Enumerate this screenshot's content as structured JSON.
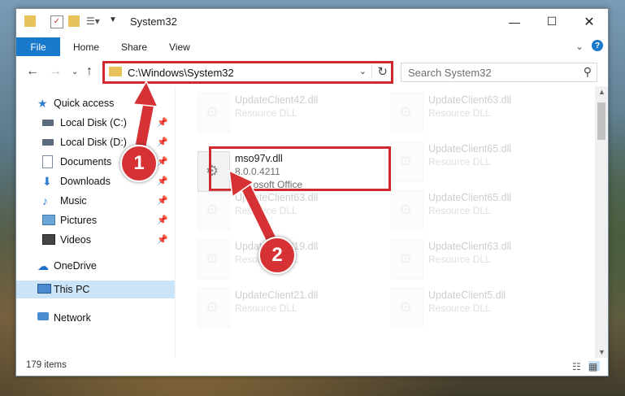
{
  "window": {
    "title": "System32"
  },
  "ribbon": {
    "tabs": [
      "File",
      "Home",
      "Share",
      "View"
    ],
    "help": "?"
  },
  "nav": {
    "address": "C:\\Windows\\System32",
    "search_placeholder": "Search System32"
  },
  "sidebar": {
    "items": [
      {
        "label": "Quick access",
        "icon": "star-icon"
      },
      {
        "label": "Local Disk (C:)",
        "icon": "drive-icon",
        "pinned": true
      },
      {
        "label": "Local Disk (D:)",
        "icon": "drive-icon",
        "pinned": true
      },
      {
        "label": "Documents",
        "icon": "documents-icon",
        "pinned": true
      },
      {
        "label": "Downloads",
        "icon": "download-icon",
        "pinned": true
      },
      {
        "label": "Music",
        "icon": "music-icon",
        "pinned": true
      },
      {
        "label": "Pictures",
        "icon": "pictures-icon",
        "pinned": true
      },
      {
        "label": "Videos",
        "icon": "videos-icon",
        "pinned": true
      },
      {
        "label": "OneDrive",
        "icon": "cloud-icon"
      },
      {
        "label": "This PC",
        "icon": "computer-icon",
        "selected": true
      },
      {
        "label": "Network",
        "icon": "network-icon"
      }
    ]
  },
  "files": [
    {
      "name": "UpdateClient42.dll",
      "desc": "Resource DLL"
    },
    {
      "name": "UpdateClient63.dll",
      "desc": "Resource DLL"
    },
    {
      "name": "mso97v.dll",
      "version": "8.0.0.4211",
      "company": "Microsoft Office"
    },
    {
      "name": "UpdateClient65.dll",
      "desc": "Resource DLL"
    },
    {
      "name": "UpdateClient63.dll",
      "desc": "Resource DLL"
    },
    {
      "name": "UpdateClient65.dll",
      "desc": "Resource DLL"
    },
    {
      "name": "UpdateClient19.dll",
      "desc": "Resource DLL"
    },
    {
      "name": "UpdateClient63.dll",
      "desc": "Resource DLL"
    },
    {
      "name": "UpdateClient21.dll",
      "desc": "Resource DLL"
    },
    {
      "name": "UpdateClient5.dll",
      "desc": "Resource DLL"
    }
  ],
  "status": {
    "items_count": "179 items"
  },
  "annotations": {
    "step1": "1",
    "step2": "2",
    "color": "#d63235"
  }
}
